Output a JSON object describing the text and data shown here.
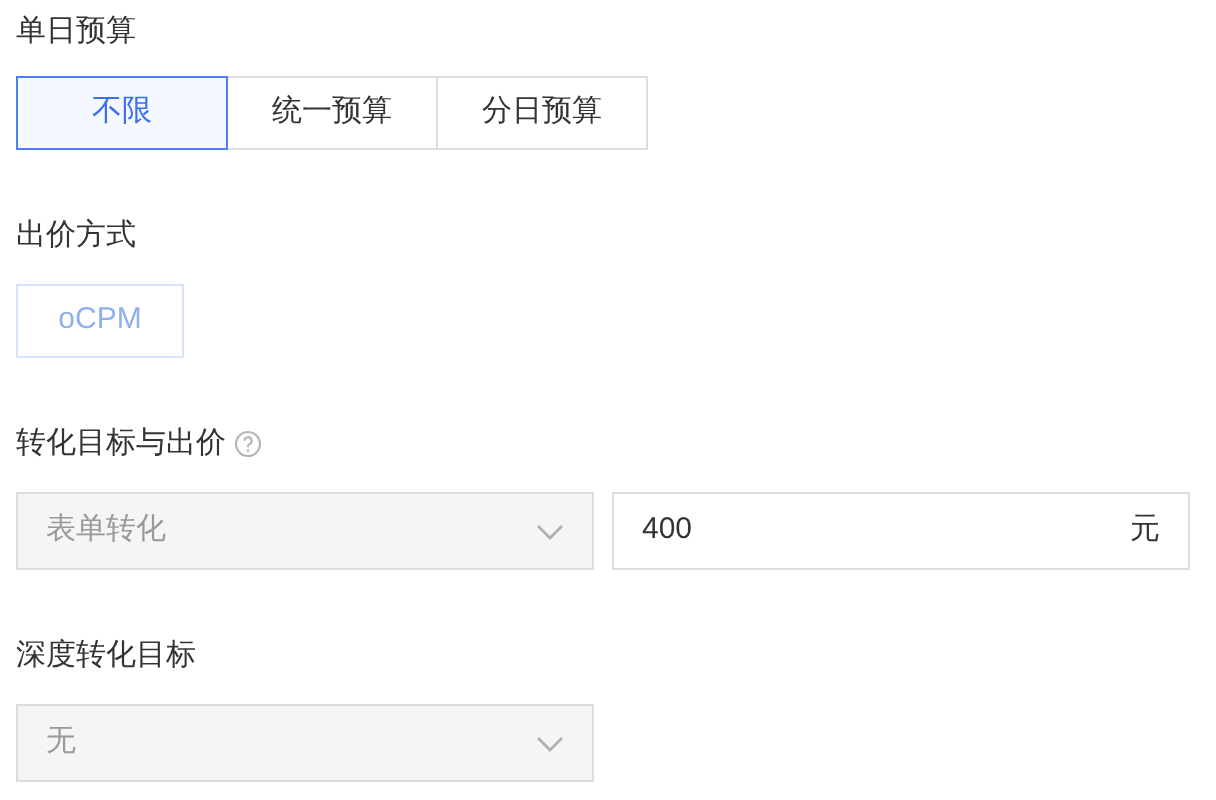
{
  "daily_budget": {
    "label": "单日预算",
    "options": [
      {
        "label": "不限",
        "selected": true
      },
      {
        "label": "统一预算",
        "selected": false
      },
      {
        "label": "分日预算",
        "selected": false
      }
    ]
  },
  "bid_method": {
    "label": "出价方式",
    "option": {
      "label": "oCPM",
      "disabled": true
    }
  },
  "conversion": {
    "label": "转化目标与出价",
    "select": {
      "value": "表单转化",
      "disabled": true
    },
    "bid": {
      "value": "400",
      "unit": "元"
    }
  },
  "deep_conversion": {
    "label": "深度转化目标",
    "select": {
      "value": "无",
      "disabled": true
    }
  }
}
